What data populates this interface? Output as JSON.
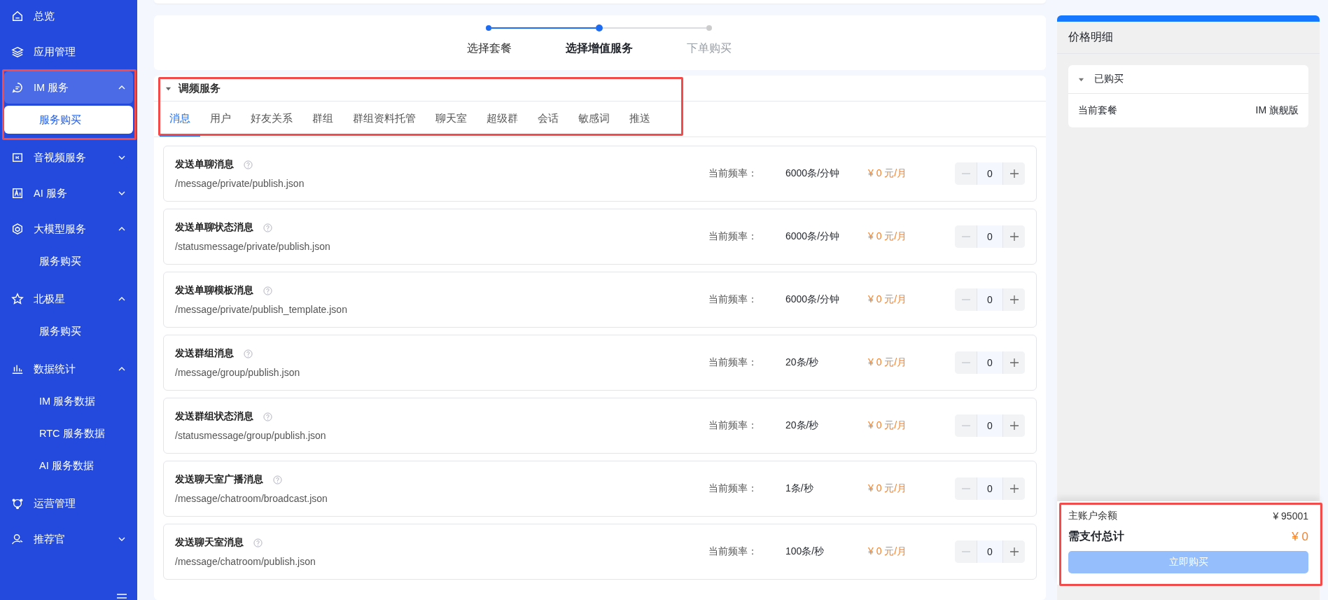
{
  "sidebar": {
    "items": [
      {
        "label": "总览",
        "selected": false,
        "highlighted": false
      },
      {
        "label": "应用管理",
        "selected": false,
        "highlighted": false
      },
      {
        "label": "IM 服务",
        "selected": true,
        "highlighted": true,
        "expanded": true,
        "children": [
          {
            "label": "服务购买",
            "selected": true
          }
        ]
      },
      {
        "label": "音视频服务",
        "selected": false,
        "highlighted": false,
        "expanded": false
      },
      {
        "label": "AI 服务",
        "selected": false,
        "highlighted": false,
        "expanded": false
      },
      {
        "label": "大模型服务",
        "selected": false,
        "highlighted": false,
        "expanded": true,
        "children": [
          {
            "label": "服务购买",
            "selected": false
          }
        ]
      },
      {
        "label": "北极星",
        "selected": false,
        "highlighted": false,
        "expanded": true,
        "children": [
          {
            "label": "服务购买",
            "selected": false
          }
        ]
      },
      {
        "label": "数据统计",
        "selected": false,
        "highlighted": false,
        "expanded": true,
        "children": [
          {
            "label": "IM 服务数据",
            "selected": false
          },
          {
            "label": "RTC 服务数据",
            "selected": false
          },
          {
            "label": "AI 服务数据",
            "selected": false
          }
        ]
      },
      {
        "label": "运营管理",
        "selected": false,
        "highlighted": false
      },
      {
        "label": "推荐官",
        "selected": false,
        "highlighted": false,
        "expanded": false
      }
    ]
  },
  "stepper": {
    "steps": [
      {
        "label": "选择套餐",
        "completed": true,
        "current": false
      },
      {
        "label": "选择增值服务",
        "completed": true,
        "current": true
      },
      {
        "label": "下单购买",
        "completed": false,
        "current": false
      }
    ]
  },
  "section": {
    "title": "调频服务",
    "expanded": true,
    "highlighted": true,
    "tabs": [
      {
        "label": "消息",
        "selected": true
      },
      {
        "label": "用户",
        "selected": false
      },
      {
        "label": "好友关系",
        "selected": false
      },
      {
        "label": "群组",
        "selected": false
      },
      {
        "label": "群组资料托管",
        "selected": false
      },
      {
        "label": "聊天室",
        "selected": false
      },
      {
        "label": "超级群",
        "selected": false
      },
      {
        "label": "会话",
        "selected": false
      },
      {
        "label": "敏感词",
        "selected": false
      },
      {
        "label": "推送",
        "selected": false
      }
    ],
    "rows": [
      {
        "name": "发送单聊消息",
        "path": "/message/private/publish.json",
        "rate_label": "当前频率：",
        "rate": "6000条/分钟",
        "price": "¥ 0 元/月",
        "quantity": "0",
        "minus_disabled": true
      },
      {
        "name": "发送单聊状态消息",
        "path": "/statusmessage/private/publish.json",
        "rate_label": "当前频率：",
        "rate": "6000条/分钟",
        "price": "¥ 0 元/月",
        "quantity": "0",
        "minus_disabled": true
      },
      {
        "name": "发送单聊模板消息",
        "path": "/message/private/publish_template.json",
        "rate_label": "当前频率：",
        "rate": "6000条/分钟",
        "price": "¥ 0 元/月",
        "quantity": "0",
        "minus_disabled": true
      },
      {
        "name": "发送群组消息",
        "path": "/message/group/publish.json",
        "rate_label": "当前频率：",
        "rate": "20条/秒",
        "price": "¥ 0 元/月",
        "quantity": "0",
        "minus_disabled": true
      },
      {
        "name": "发送群组状态消息",
        "path": "/statusmessage/group/publish.json",
        "rate_label": "当前频率：",
        "rate": "20条/秒",
        "price": "¥ 0 元/月",
        "quantity": "0",
        "minus_disabled": true
      },
      {
        "name": "发送聊天室广播消息",
        "path": "/message/chatroom/broadcast.json",
        "rate_label": "当前频率：",
        "rate": "1条/秒",
        "price": "¥ 0 元/月",
        "quantity": "0",
        "minus_disabled": true
      },
      {
        "name": "发送聊天室消息",
        "path": "/message/chatroom/publish.json",
        "rate_label": "当前频率：",
        "rate": "100条/秒",
        "price": "¥ 0 元/月",
        "quantity": "0",
        "minus_disabled": true
      }
    ]
  },
  "price_panel": {
    "title": "价格明细",
    "purchased": {
      "title": "已购买",
      "expanded": true,
      "rows": [
        {
          "label": "当前套餐",
          "value": "IM 旗舰版"
        }
      ]
    },
    "footer": {
      "highlighted": true,
      "balance_label": "主账户余额",
      "balance": "¥ 95001",
      "total_label": "需支付总计",
      "total": "¥ 0",
      "button": {
        "label": "立即购买",
        "disabled": true
      }
    }
  }
}
